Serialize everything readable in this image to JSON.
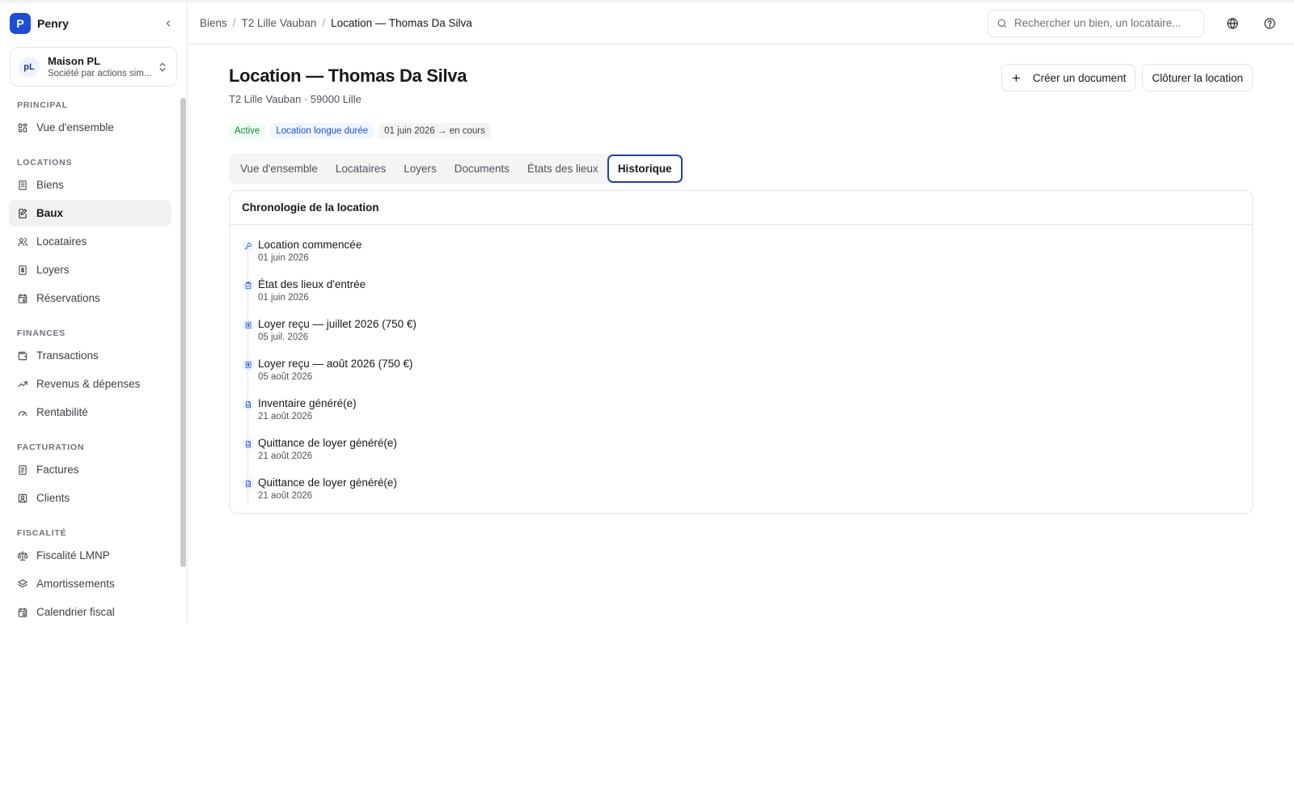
{
  "brand": {
    "logo": "P",
    "name": "Penry"
  },
  "organization": {
    "initials": "pL",
    "name": "Maison PL",
    "type": "Société par actions sim..."
  },
  "nav": {
    "sections": [
      {
        "label": "PRINCIPAL",
        "items": [
          {
            "label": "Vue d'ensemble",
            "icon": "dashboard-icon"
          }
        ]
      },
      {
        "label": "LOCATIONS",
        "items": [
          {
            "label": "Biens",
            "icon": "building-icon"
          },
          {
            "label": "Baux",
            "icon": "lease-icon",
            "active": true
          },
          {
            "label": "Locataires",
            "icon": "users-icon"
          },
          {
            "label": "Loyers",
            "icon": "receipt-icon"
          },
          {
            "label": "Réservations",
            "icon": "calendar-icon"
          }
        ]
      },
      {
        "label": "FINANCES",
        "items": [
          {
            "label": "Transactions",
            "icon": "wallet-icon"
          },
          {
            "label": "Revenus & dépenses",
            "icon": "trend-icon"
          },
          {
            "label": "Rentabilité",
            "icon": "gauge-icon"
          }
        ]
      },
      {
        "label": "FACTURATION",
        "items": [
          {
            "label": "Factures",
            "icon": "invoice-icon"
          },
          {
            "label": "Clients",
            "icon": "client-icon"
          }
        ]
      },
      {
        "label": "FISCALITÉ",
        "items": [
          {
            "label": "Fiscalité LMNP",
            "icon": "scale-icon"
          },
          {
            "label": "Amortissements",
            "icon": "layers-icon"
          },
          {
            "label": "Calendrier fiscal",
            "icon": "calendar-icon"
          }
        ]
      }
    ]
  },
  "breadcrumb": [
    "Biens",
    "T2 Lille Vauban",
    "Location — Thomas Da Silva"
  ],
  "search": {
    "placeholder": "Rechercher un bien, un locataire..."
  },
  "page": {
    "title": "Location — Thomas Da Silva",
    "subtitle": "T2 Lille Vauban · 59000 Lille",
    "badges": [
      {
        "label": "Active",
        "tone": "green"
      },
      {
        "label": "Location longue durée",
        "tone": "blue"
      },
      {
        "label": "01 juin 2026 → en cours",
        "tone": "gray"
      }
    ],
    "actions": {
      "create": "Créer un document",
      "close": "Clôturer la location"
    }
  },
  "tabs": [
    {
      "label": "Vue d'ensemble"
    },
    {
      "label": "Locataires"
    },
    {
      "label": "Loyers"
    },
    {
      "label": "Documents"
    },
    {
      "label": "États des lieux"
    },
    {
      "label": "Historique",
      "active": true
    }
  ],
  "timeline": {
    "title": "Chronologie de la location",
    "events": [
      {
        "title": "Location commencée",
        "date": "01 juin 2026",
        "icon": "key-icon"
      },
      {
        "title": "État des lieux d'entrée",
        "date": "01 juin 2026",
        "icon": "clipboard-icon"
      },
      {
        "title": "Loyer reçu — juillet 2026 (750 €)",
        "date": "05 juil. 2026",
        "icon": "receipt-icon"
      },
      {
        "title": "Loyer reçu — août 2026 (750 €)",
        "date": "05 août 2026",
        "icon": "receipt-icon"
      },
      {
        "title": "Inventaire généré(e)",
        "date": "21 août 2026",
        "icon": "document-icon"
      },
      {
        "title": "Quittance de loyer généré(e)",
        "date": "21 août 2026",
        "icon": "document-icon"
      },
      {
        "title": "Quittance de loyer généré(e)",
        "date": "21 août 2026",
        "icon": "document-icon"
      }
    ]
  },
  "colors": {
    "accent": "#1d4ed8",
    "active_tab_border": "#1e40af",
    "success": "#15803d"
  }
}
